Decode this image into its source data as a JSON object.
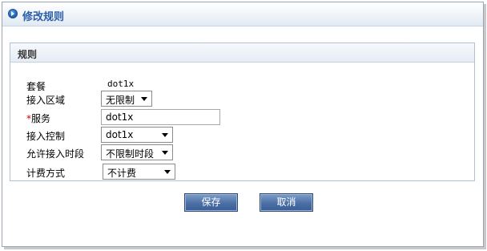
{
  "window": {
    "title": "修改规则"
  },
  "panel": {
    "title": "规则"
  },
  "form": {
    "package": {
      "label": "套餐",
      "value": "dot1x"
    },
    "access_area": {
      "label": "接入区域",
      "value": "无限制"
    },
    "service": {
      "required_mark": "*",
      "label": "服务",
      "value": "dot1x"
    },
    "access_control": {
      "label": "接入控制",
      "value": "dot1x"
    },
    "allowed_time": {
      "label": "允许接入时段",
      "value": "不限制时段"
    },
    "billing": {
      "label": "计费方式",
      "value": "不计费"
    }
  },
  "buttons": {
    "save": "保存",
    "cancel": "取消"
  },
  "colors": {
    "accent": "#2a5ea8",
    "button": "#4b6fa5",
    "required": "#d00000"
  },
  "icons": {
    "title": "arrow-circle-icon"
  }
}
